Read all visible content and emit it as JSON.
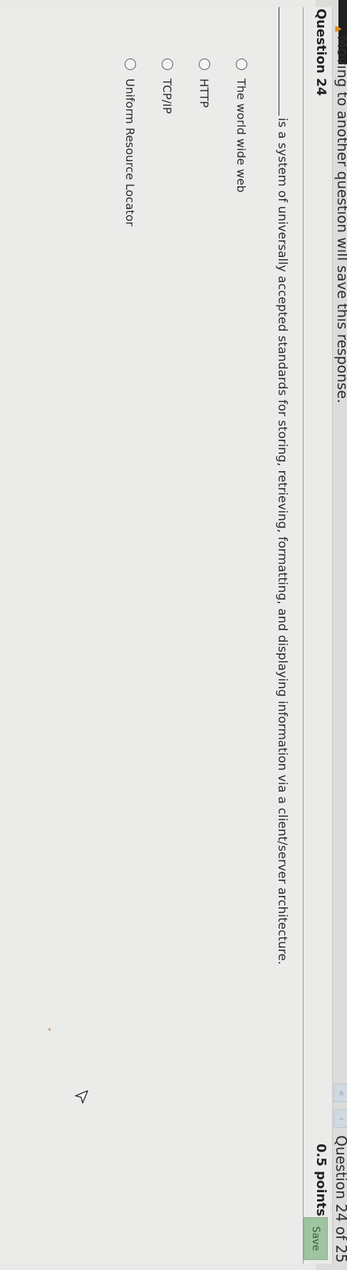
{
  "topbar": {
    "message": "Moving to another question will save this response.",
    "question_counter": "Question 24 of 25",
    "prev_icon": "double-chevron-left-icon",
    "back_icon": "chevron-left-icon",
    "warning_icon": "warning-icon"
  },
  "question": {
    "title": "Question 24",
    "points": "0.5 points",
    "save_label": "Save",
    "prompt": "is a system of universally accepted standards for storing, retrieving, formatting, and displaying information via a client/server architecture.",
    "options": [
      {
        "label": "The world wide web"
      },
      {
        "label": "HTTP"
      },
      {
        "label": "TCP/IP"
      },
      {
        "label": "Uniform Resource Locator"
      }
    ]
  },
  "colors": {
    "save_button": "#9ec4a0",
    "nav_button": "#c9d7e6",
    "background": "#e9e9e7",
    "warning": "#e08a1e"
  }
}
